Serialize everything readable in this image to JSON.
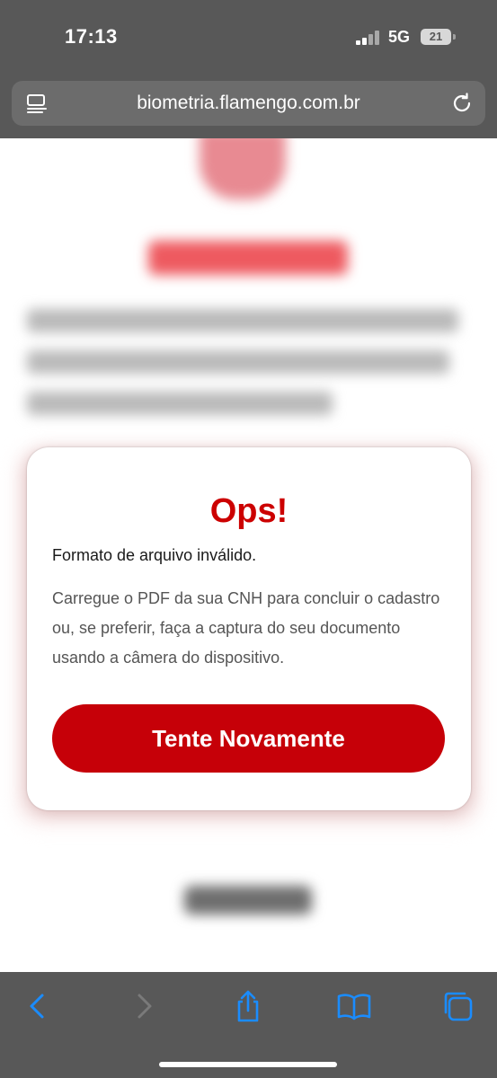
{
  "status_bar": {
    "time": "17:13",
    "network": "5G",
    "battery": "21"
  },
  "browser": {
    "url": "biometria.flamengo.com.br",
    "tabs_icon": "reader-list-icon",
    "reload_icon": "reload-icon"
  },
  "modal": {
    "title": "Ops!",
    "subtitle": "Formato de arquivo inválido.",
    "message": "Carregue o PDF da sua CNH para concluir o cadastro ou, se preferir, faça a captura do seu documento usando a câmera do dispositivo.",
    "button_label": "Tente Novamente"
  },
  "toolbar": {
    "icons": [
      "back-icon",
      "forward-icon",
      "share-icon",
      "bookmarks-icon",
      "tabs-icon"
    ]
  },
  "colors": {
    "accent": "#cc0000",
    "button": "#c60008",
    "chrome": "#585858",
    "toolbar_icon_active": "#1a8cff",
    "toolbar_icon_disabled": "#7a7a7a"
  }
}
